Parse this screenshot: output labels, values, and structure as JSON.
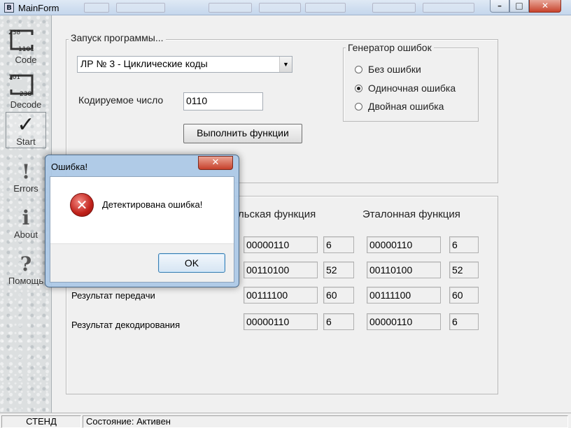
{
  "window": {
    "title": "MainForm",
    "icon_glyph": "B",
    "controls": {
      "minimize": "–",
      "maximize": "□",
      "close": "✕"
    }
  },
  "sidebar": {
    "items": [
      {
        "label": "Code",
        "icon": "code-icon",
        "num_top": "238",
        "num_bottom": "1101"
      },
      {
        "label": "Decode",
        "icon": "decode-icon",
        "num_top": "101",
        "num_bottom": "238"
      },
      {
        "label": "Start",
        "icon": "check-icon",
        "glyph": "✓"
      },
      {
        "label": "Errors",
        "icon": "exclamation-icon",
        "glyph": "!"
      },
      {
        "label": "About",
        "icon": "info-icon",
        "glyph": "i"
      },
      {
        "label": "Помощь",
        "icon": "question-icon",
        "glyph": "?"
      }
    ]
  },
  "launch_group": {
    "legend": "Запуск программы...",
    "program_select": {
      "value": "ЛР № 3 - Циклические коды",
      "arrow": "▼"
    },
    "encoded_label": "Кодируемое число",
    "encoded_value": "0110",
    "run_button": "Выполнить функции"
  },
  "error_generator": {
    "legend": "Генератор ошибок",
    "options": [
      {
        "label": "Без ошибки",
        "selected": false
      },
      {
        "label": "Одиночная ошибка",
        "selected": true
      },
      {
        "label": "Двойная ошибка",
        "selected": false
      }
    ]
  },
  "results": {
    "user_header": "льская функция",
    "reference_header": "Эталонная функция",
    "rows": [
      {
        "label": "",
        "user_bin": "00000110",
        "user_dec": "6",
        "ref_bin": "00000110",
        "ref_dec": "6"
      },
      {
        "label": "",
        "user_bin": "00110100",
        "user_dec": "52",
        "ref_bin": "00110100",
        "ref_dec": "52"
      },
      {
        "label": "Результат передачи",
        "user_bin": "00111100",
        "user_dec": "60",
        "ref_bin": "00111100",
        "ref_dec": "60"
      },
      {
        "label": "Результат декодирования",
        "user_bin": "00000110",
        "user_dec": "6",
        "ref_bin": "00000110",
        "ref_dec": "6"
      }
    ]
  },
  "statusbar": {
    "left": "СТЕНД",
    "status": "Состояние: Активен"
  },
  "dialog": {
    "title": "Ошибка!",
    "close_glyph": "✕",
    "icon_glyph": "✕",
    "message": "Детектирована ошибка!",
    "ok_button": "OK"
  },
  "colors": {
    "error_red": "#c0211a",
    "title_bar": "#c4d6ec",
    "dialog_frame": "#aac8e6"
  }
}
